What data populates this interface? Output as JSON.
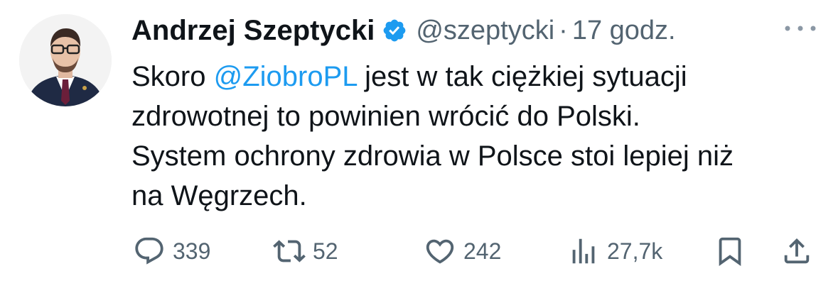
{
  "tweet": {
    "author_name": "Andrzej Szeptycki",
    "handle": "@szeptycki",
    "separator": "·",
    "time": "17 godz.",
    "text": {
      "line1_pre": "Skoro ",
      "mention": "@ZiobroPL",
      "line1_post": " jest w tak ciężkiej sytuacji",
      "line2": "zdrowotnej to powinien wrócić do Polski.",
      "line3": "System ochrony zdrowia w Polsce stoi lepiej niż",
      "line4": "na Węgrzech."
    },
    "actions": {
      "replies": "339",
      "retweets": "52",
      "likes": "242",
      "views": "27,7k"
    }
  },
  "colors": {
    "text": "#0f1419",
    "muted": "#536471",
    "accent": "#1d9bf0"
  },
  "icons": [
    "verified-badge-icon",
    "more-options-icon",
    "reply-icon",
    "retweet-icon",
    "like-icon",
    "views-icon",
    "bookmark-icon",
    "share-icon"
  ]
}
